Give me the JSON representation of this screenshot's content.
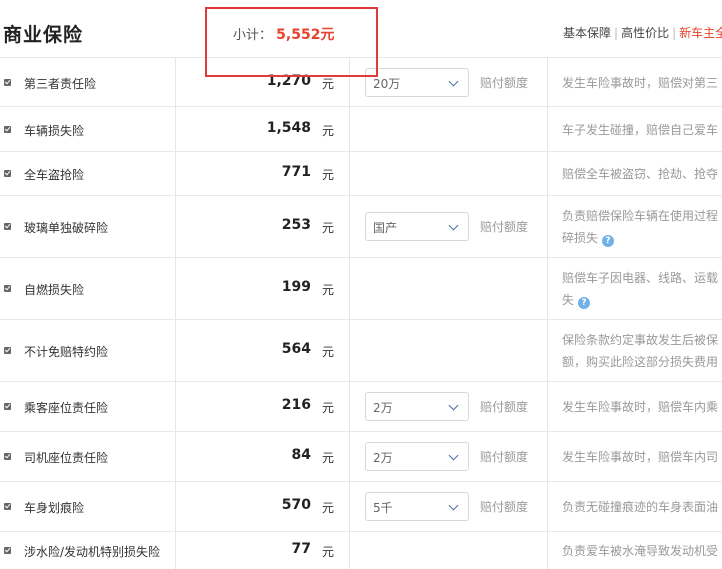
{
  "header": {
    "title": "商业保险",
    "subtotal_label": "小计：",
    "subtotal_value": "5,552元",
    "plans": [
      {
        "label": "基本保障"
      },
      {
        "label": "高性价比"
      },
      {
        "label": "新车主全"
      }
    ],
    "plan_separator": "|"
  },
  "unit": "元",
  "claim_label": "赔付额度",
  "rows": [
    {
      "name": "第三者责任险",
      "price": "1,270",
      "select": "20万",
      "desc": [
        "发生车险事故时，赔偿对第三"
      ]
    },
    {
      "name": "车辆损失险",
      "price": "1,548",
      "select": null,
      "desc": [
        "车子发生碰撞，赔偿自己爱车"
      ]
    },
    {
      "name": "全车盗抢险",
      "price": "771",
      "select": null,
      "desc": [
        "赔偿全车被盗窃、抢劫、抢夺"
      ]
    },
    {
      "name": "玻璃单独破碎险",
      "price": "253",
      "select": "国产",
      "desc": [
        "负责赔偿保险车辆在使用过程",
        "碎损失"
      ]
    },
    {
      "name": "自燃损失险",
      "price": "199",
      "select": null,
      "desc": [
        "赔偿车子因电器、线路、运载",
        "失"
      ]
    },
    {
      "name": "不计免赔特约险",
      "price": "564",
      "select": null,
      "desc": [
        "保险条款约定事故发生后被保",
        "额，购买此险这部分损失费用"
      ]
    },
    {
      "name": "乘客座位责任险",
      "price": "216",
      "select": "2万",
      "desc": [
        "发生车险事故时，赔偿车内乘"
      ]
    },
    {
      "name": "司机座位责任险",
      "price": "84",
      "select": "2万",
      "desc": [
        "发生车险事故时，赔偿车内司"
      ]
    },
    {
      "name": "车身划痕险",
      "price": "570",
      "select": "5千",
      "desc": [
        "负责无碰撞痕迹的车身表面油"
      ]
    },
    {
      "name": "涉水险/发动机特别损失险",
      "price": "77",
      "select": null,
      "desc": [
        "负责爱车被水淹导致发动机受"
      ]
    }
  ]
}
